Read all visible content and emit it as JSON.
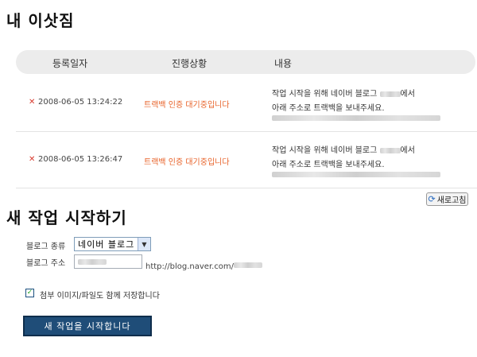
{
  "page": {
    "title": "내 이삿짐"
  },
  "table": {
    "headers": [
      "등록일자",
      "진행상황",
      "내용"
    ],
    "rows": [
      {
        "delete_icon": "close-icon",
        "date": "2008-06-05 13:24:22",
        "status": "트랙백 인증 대기중입니다",
        "content_line1_prefix": "작업 시작을 위해 네이버 블로그",
        "content_line1_suffix": "에서",
        "content_line2": "아래 주소로 트랙백을 보내주세요."
      },
      {
        "delete_icon": "close-icon",
        "date": "2008-06-05 13:26:47",
        "status": "트랙백 인증 대기중입니다",
        "content_line1_prefix": "작업 시작을 위해 네이버 블로그",
        "content_line1_suffix": "에서",
        "content_line2": "아래 주소로 트랙백을 보내주세요."
      }
    ]
  },
  "refresh": {
    "icon": "refresh-icon",
    "label": "새로고침"
  },
  "new_job": {
    "title": "새 작업 시작하기",
    "blog_type_label": "블로그 종류",
    "blog_type_value": "네이버 블로그",
    "blog_address_label": "블로그 주소",
    "blog_address_prefix": "http://blog.naver.com/",
    "save_attachments_label": "첨부 이미지/파일도 함께 저장합니다",
    "save_attachments_checked": true,
    "start_button_label": "새 작업을 시작합니다"
  },
  "colors": {
    "status_orange": "#e8632a",
    "delete_red": "#d83a2e",
    "start_button_bg": "#1f4d78"
  }
}
